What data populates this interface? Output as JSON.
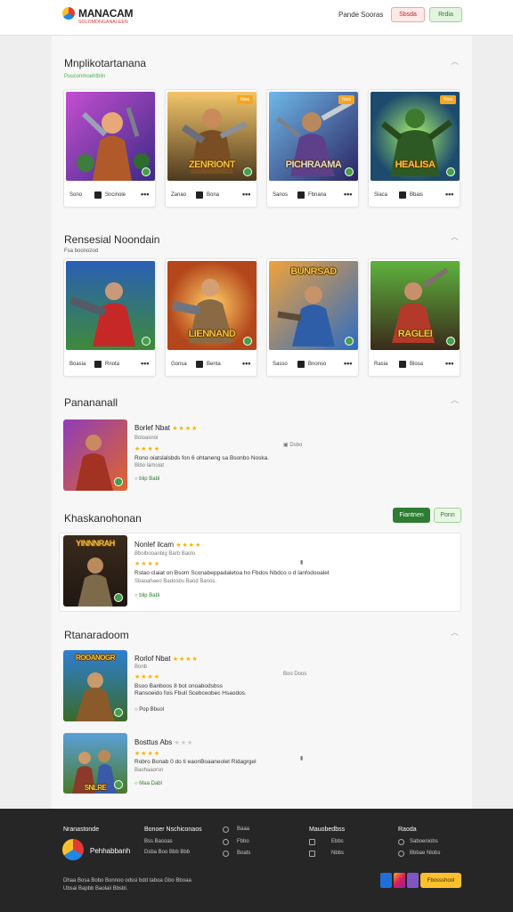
{
  "header": {
    "logo_text": "MANACAM",
    "logo_tagline": "SOLOMONGANALEEN",
    "links": [
      "Pande",
      "Sooras"
    ],
    "login_label": "Sbsda",
    "signup_label": "Rrdia"
  },
  "section1": {
    "title": "Mnplikotartanana",
    "subtitle": "Puuconmoehtbiin",
    "cards": [
      {
        "art_title": "",
        "badge": "",
        "foot_left": "Sono",
        "foot_right": "Sncinole",
        "more": "•••"
      },
      {
        "art_title": "ZENRIONT",
        "badge": "Nios",
        "foot_left": "Zanao",
        "foot_right": "Bona",
        "more": "•••"
      },
      {
        "art_title": "PICHRAAMA",
        "badge": "Nios",
        "foot_left": "Sanos",
        "foot_right": "Fbnana",
        "more": "•••"
      },
      {
        "art_title": "HEALISA",
        "badge": "Nios",
        "foot_left": "Siaca",
        "foot_right": "Bbais",
        "more": "•••"
      }
    ]
  },
  "section2": {
    "title": "Rensesial Noondain",
    "subtitle": "Fsa boonozod",
    "cards": [
      {
        "art_title": "",
        "foot_left": "Boasia",
        "foot_right": "Rnota",
        "more": "•••"
      },
      {
        "art_title": "LIENNAND",
        "foot_left": "Gonsa",
        "foot_right": "Benta",
        "more": "•••"
      },
      {
        "art_title": "BUNRSAD",
        "foot_left": "Sasso",
        "foot_right": "Bnonso",
        "more": "•••"
      },
      {
        "art_title": "RAGLEI",
        "foot_left": "Rasia",
        "foot_right": "Blosa",
        "more": "•••"
      }
    ]
  },
  "section3": {
    "title": "Panananall",
    "item": {
      "title": "Borlef Nbat",
      "stars": "★★★★",
      "meta": "Boloasnoi",
      "stars2": "★★★★",
      "desc1": "Rono oiatslalsbds fon 6 ohtaneng sa Bsonbo Noska.",
      "desc2": "Bibo lamoiat",
      "link": "blip Babl",
      "side_meta": "Dsbo"
    }
  },
  "section4": {
    "title": "Khaskanohonan",
    "primary_label": "Fiantnen",
    "secondary_label": "Ponn",
    "item": {
      "art_title": "YINNNRAH",
      "title": "Nonlef ilcam",
      "stars": "★★★★",
      "meta": "Bbolbooanbig  Barb  Baolo",
      "stars2": "★★★★",
      "desc1": "Rstao claiat on Bsom Sconabeppadaletoa ho Fbdos Nbdco o d lanfodooalet",
      "desc2": "Sbaoahaeo Badosbu Baod Banos.",
      "link": "blip Babl"
    }
  },
  "section5": {
    "title": "Rtanaradoom",
    "items": [
      {
        "art_title": "ROOANOGR",
        "title": "Rorlof Nbat",
        "stars": "★★★★",
        "meta": "Bonb",
        "stars2": "★★★★",
        "desc1": "Bsoo Banboos 8 bot onoabodsbss",
        "desc2": "Ransoeido fois Fbull Scebceobec Hsaodos.",
        "link": "Pop Bbuol",
        "side_meta": "Boo Doos"
      },
      {
        "art_title": "SNLRE",
        "title": "Bosttus Abs",
        "stars_grey": "★★★",
        "stars2": "★★★★",
        "desc1": "Robro Bonab 0 do ti eaonBoaaneolet Ridagrgel",
        "meta": "Baohaaorsn",
        "link": "Maa Dabl"
      }
    ]
  },
  "footer": {
    "heading1": "Nranastonde",
    "brand_name": "Pehhabbanh",
    "text1": "Dhaa Bosa Bobo Bonnoo odssi bdd taboa Gbo Bboaa",
    "text2": "Ubsai Bapbb Baolaii Bbsbl.",
    "col2_head": "Bonoer Nschiconaos",
    "col2_items": [
      "Bss Basoas",
      "Dsba Boo Bbb Bbb"
    ],
    "col3_items": [
      "Baaa",
      "Fbbo",
      "Boats"
    ],
    "col4_head": "Mauobedbss",
    "col4_items": [
      "Ebbs",
      "Nbbs"
    ],
    "col5_head": "Raoda",
    "col5_items": [
      "Saboeniobs",
      "Bbbae Nlobs"
    ],
    "cta_label": "Fbossshool",
    "social_icons": [
      "facebook-icon",
      "instagram-icon",
      "mail-icon"
    ]
  }
}
